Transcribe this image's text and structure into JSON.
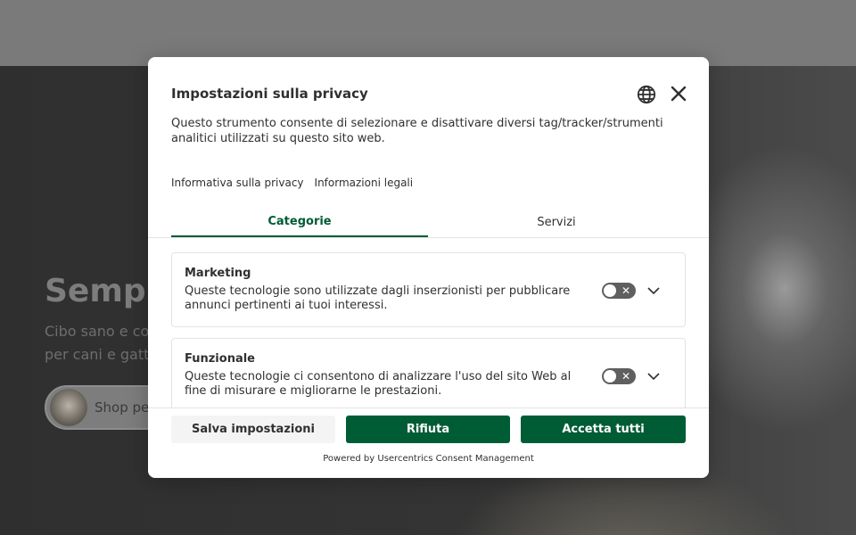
{
  "background": {
    "hero_title": "Sempl",
    "hero_subtitle": "Cibo sano e co per cani e gatt",
    "shop_button_label": "Shop per"
  },
  "modal": {
    "title": "Impostazioni sulla privacy",
    "description": "Questo strumento consente di selezionare e disattivare diversi tag/tracker/strumenti analitici utilizzati su questo sito web.",
    "links": [
      "Informativa sulla privacy",
      "Informazioni legali"
    ],
    "tabs": [
      {
        "label": "Categorie",
        "active": true
      },
      {
        "label": "Servizi",
        "active": false
      }
    ],
    "categories": [
      {
        "title": "Marketing",
        "description": "Queste tecnologie sono utilizzate dagli inserzionisti per pubblicare annunci pertinenti ai tuoi interessi.",
        "enabled": false
      },
      {
        "title": "Funzionale",
        "description": "Queste tecnologie ci consentono di analizzare l'uso del sito Web al fine di misurare e migliorarne le prestazioni.",
        "enabled": false
      }
    ],
    "buttons": {
      "save": "Salva impostazioni",
      "deny": "Rifiuta",
      "accept": "Accetta tutti"
    },
    "powered_by": "Powered by Usercentrics Consent Management"
  },
  "colors": {
    "accent": "#005c35",
    "toggle_off": "#5f5f5f",
    "text": "#303030",
    "overlay_page": "#3a3a3a"
  },
  "icons": {
    "language": "globe-icon",
    "close": "close-icon",
    "expand": "chevron-down-icon",
    "toggle_off_mark": "✕"
  }
}
